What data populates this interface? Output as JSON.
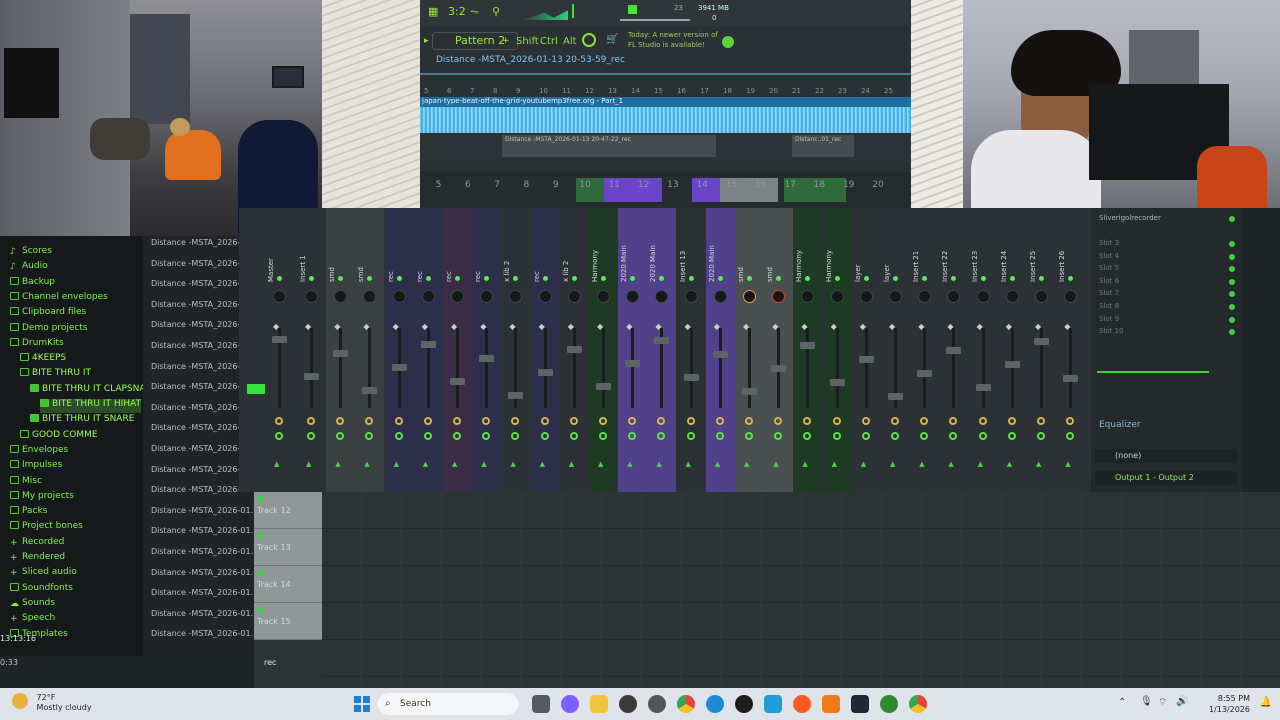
{
  "fl_top": {
    "cpu": "3941 MB",
    "ram": "0",
    "tempo_digits": "23",
    "pattern": "Pattern 2",
    "mod_keys": [
      "Shift",
      "Ctrl",
      "Alt"
    ],
    "news": "Today: A newer version of FL Studio is available!",
    "playlist_path": "Distance -MSTA_2026-01-13 20-53-59_rec",
    "ruler": [
      "5",
      "6",
      "7",
      "8",
      "9",
      "10",
      "11",
      "12",
      "13",
      "14",
      "15",
      "16",
      "17",
      "18",
      "19",
      "20",
      "21",
      "22",
      "23",
      "24",
      "25"
    ],
    "audio_label": "japan-type-beat-off-the-grid-youtubemp3free.org - Part_1",
    "clips": [
      "Distance -MSTA_2026-01-13 20-47-22_rec",
      "Distanc..01_rec"
    ]
  },
  "mixer_head": {
    "numbers": [
      "5",
      "6",
      "7",
      "8",
      "9",
      "10",
      "11",
      "12",
      "13",
      "14",
      "15",
      "16",
      "17",
      "18",
      "19",
      "20"
    ]
  },
  "browser": {
    "items": [
      {
        "label": "Scores",
        "type": "note"
      },
      {
        "label": "Audio",
        "type": "note"
      },
      {
        "label": "Backup",
        "type": "folder"
      },
      {
        "label": "Channel envelopes",
        "type": "folder"
      },
      {
        "label": "Clipboard files",
        "type": "folder"
      },
      {
        "label": "Demo projects",
        "type": "folder"
      },
      {
        "label": "DrumKits",
        "type": "folder"
      },
      {
        "label": "4KEEPS",
        "type": "folder",
        "sub": 1
      },
      {
        "label": "BITE THRU IT",
        "type": "folder",
        "sub": 1
      },
      {
        "label": "BITE THRU IT CLAPSNARE",
        "type": "grid",
        "sub": 2
      },
      {
        "label": "BITE THRU IT HIHAT",
        "type": "grid",
        "sub": 3,
        "selected": true
      },
      {
        "label": "BITE THRU IT SNARE",
        "type": "grid",
        "sub": 2
      },
      {
        "label": "GOOD COMME",
        "type": "folder",
        "sub": 1
      },
      {
        "label": "Envelopes",
        "type": "folder"
      },
      {
        "label": "Impulses",
        "type": "folder"
      },
      {
        "label": "Misc",
        "type": "folder"
      },
      {
        "label": "My projects",
        "type": "folder"
      },
      {
        "label": "Packs",
        "type": "folder"
      },
      {
        "label": "Project bones",
        "type": "folder"
      },
      {
        "label": "Recorded",
        "type": "plus"
      },
      {
        "label": "Rendered",
        "type": "plus"
      },
      {
        "label": "Sliced audio",
        "type": "plus"
      },
      {
        "label": "Soundfonts",
        "type": "folder"
      },
      {
        "label": "Sounds",
        "type": "cloud"
      },
      {
        "label": "Speech",
        "type": "plus"
      },
      {
        "label": "Templates",
        "type": "folder"
      }
    ]
  },
  "tracknames": {
    "label": "Distance -MSTA_2026-01..."
  },
  "mixer": {
    "strips": [
      "Master",
      "Insert 1",
      "smd",
      "smd",
      "rec",
      "rec",
      "rec",
      "rec",
      "x lib 2",
      "rec",
      "x lib 2",
      "Harmony",
      "2020 Main",
      "2020 Main",
      "Insert 13",
      "2020 Main",
      "smd",
      "smd",
      "Harmony",
      "Harmony",
      "layer",
      "layer",
      "Insert 21",
      "Insert 22",
      "Insert 23",
      "Insert 24",
      "Insert 25",
      "Insert 26"
    ]
  },
  "mix_right": {
    "top_slot": "Sliverigolrecorder",
    "slots": [
      "Slot 3",
      "Slot 4",
      "Slot 5",
      "Slot 6",
      "Slot 7",
      "Slot 8",
      "Slot 9",
      "Slot 10"
    ],
    "eq_label": "Equalizer",
    "input": "(none)",
    "output": "Output 1 - Output 2"
  },
  "playlist": {
    "tracks": [
      "Track 12",
      "Track 13",
      "Track 14",
      "Track 15"
    ],
    "rec_label": "rec"
  },
  "overlay": {
    "clock": "13:13:16",
    "elapsed": "0:33"
  },
  "taskbar": {
    "temp": "72°F",
    "weather": "Mostly cloudy",
    "search": "Search",
    "time": "8:55 PM",
    "date": "1/13/2026"
  }
}
